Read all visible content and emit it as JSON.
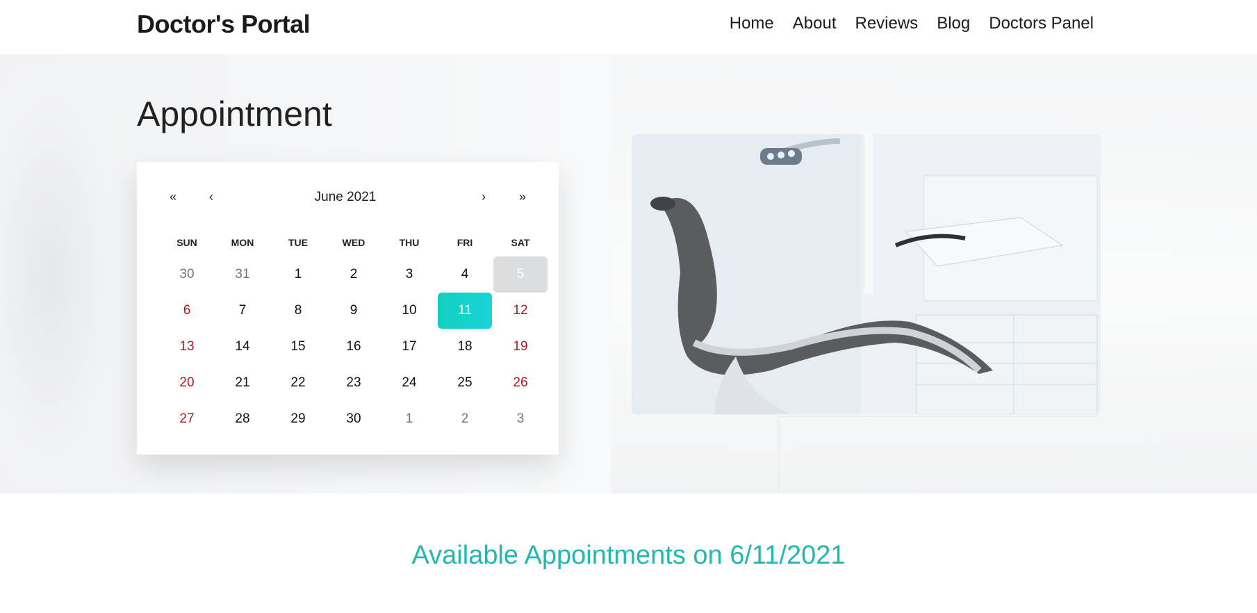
{
  "brand": "Doctor's Portal",
  "nav": [
    "Home",
    "About",
    "Reviews",
    "Blog",
    "Doctors Panel"
  ],
  "page_title": "Appointment",
  "calendar": {
    "month_label": "June 2021",
    "prev_year": "«",
    "prev_month": "‹",
    "next_month": "›",
    "next_year": "»",
    "weekdays": [
      "SUN",
      "MON",
      "TUE",
      "WED",
      "THU",
      "FRI",
      "SAT"
    ],
    "days": [
      {
        "label": "30",
        "state": "muted"
      },
      {
        "label": "31",
        "state": "muted"
      },
      {
        "label": "1"
      },
      {
        "label": "2"
      },
      {
        "label": "3"
      },
      {
        "label": "4"
      },
      {
        "label": "5",
        "state": "today"
      },
      {
        "label": "6",
        "state": "weekend"
      },
      {
        "label": "7"
      },
      {
        "label": "8"
      },
      {
        "label": "9"
      },
      {
        "label": "10"
      },
      {
        "label": "11",
        "state": "selected"
      },
      {
        "label": "12",
        "state": "weekend"
      },
      {
        "label": "13",
        "state": "weekend"
      },
      {
        "label": "14"
      },
      {
        "label": "15"
      },
      {
        "label": "16"
      },
      {
        "label": "17"
      },
      {
        "label": "18"
      },
      {
        "label": "19",
        "state": "weekend"
      },
      {
        "label": "20",
        "state": "weekend"
      },
      {
        "label": "21"
      },
      {
        "label": "22"
      },
      {
        "label": "23"
      },
      {
        "label": "24"
      },
      {
        "label": "25"
      },
      {
        "label": "26",
        "state": "weekend"
      },
      {
        "label": "27",
        "state": "weekend"
      },
      {
        "label": "28"
      },
      {
        "label": "29"
      },
      {
        "label": "30"
      },
      {
        "label": "1",
        "state": "muted"
      },
      {
        "label": "2",
        "state": "muted"
      },
      {
        "label": "3",
        "state": "muted"
      }
    ]
  },
  "available_title": "Available Appointments on 6/11/2021",
  "colors": {
    "accent": "#22b8b0",
    "selected_day": "#14d0c4",
    "weekend_day": "#c0121a",
    "muted_day": "#757575",
    "today_bg": "#dcdddf"
  }
}
